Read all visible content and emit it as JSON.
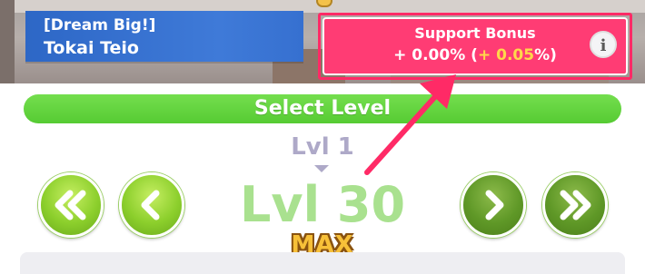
{
  "card": {
    "title": "[Dream Big!]",
    "name": "Tokai Teio"
  },
  "support_bonus": {
    "label": "Support Bonus",
    "base_value": "+ 0.00%",
    "open_paren": " (",
    "extra_value": "+ 0.05",
    "close_paren": "%)",
    "info_symbol": "i"
  },
  "select_level": {
    "label": "Select Level"
  },
  "level": {
    "previous": "Lvl 1",
    "current": "Lvl 30",
    "max_badge": "MAX"
  },
  "buttons": {
    "min_level": {
      "icon": "double-chevron-left-icon"
    },
    "decrease_level": {
      "icon": "chevron-left-icon"
    },
    "increase_level": {
      "icon": "chevron-right-icon"
    },
    "max_level": {
      "icon": "double-chevron-right-icon"
    }
  },
  "colors": {
    "bonus_bg": "#ff3c74",
    "bonus_highlight": "#ffd84a",
    "select_bar": "#5fd23a",
    "level_text": "#a9e18f",
    "annotation_arrow": "#ff2a66"
  }
}
